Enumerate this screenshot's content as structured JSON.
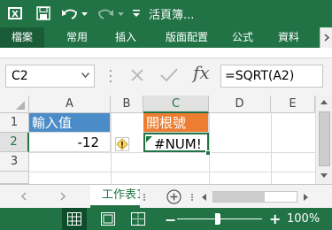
{
  "titlebar": {
    "title": "活頁簿...",
    "icons": [
      "excel-logo",
      "save-icon",
      "undo-icon",
      "redo-icon",
      "customize-qat-icon"
    ]
  },
  "ribbon": {
    "tabs": [
      {
        "label": "檔案",
        "active": true
      },
      {
        "label": "常用"
      },
      {
        "label": "插入"
      },
      {
        "label": "版面配置"
      },
      {
        "label": "公式"
      },
      {
        "label": "資料"
      }
    ]
  },
  "formula_bar": {
    "name_box": "C2",
    "fx_label": "fx",
    "formula": "=SQRT(A2)"
  },
  "grid": {
    "columns": [
      "A",
      "B",
      "C",
      "D",
      "E"
    ],
    "selected_column": "C",
    "rows": [
      "1",
      "2",
      "3"
    ],
    "selected_row": "2",
    "cells": {
      "A1": "輸入值",
      "C1": "開根號",
      "A2": "-12",
      "C2": "#NUM!"
    }
  },
  "sheets": {
    "active": "工作表1"
  },
  "status": {
    "zoom": "100%"
  },
  "colors": {
    "excel_green": "#217346",
    "header_orange": "#ed7d31",
    "header_blue": "#4a8cc7"
  }
}
